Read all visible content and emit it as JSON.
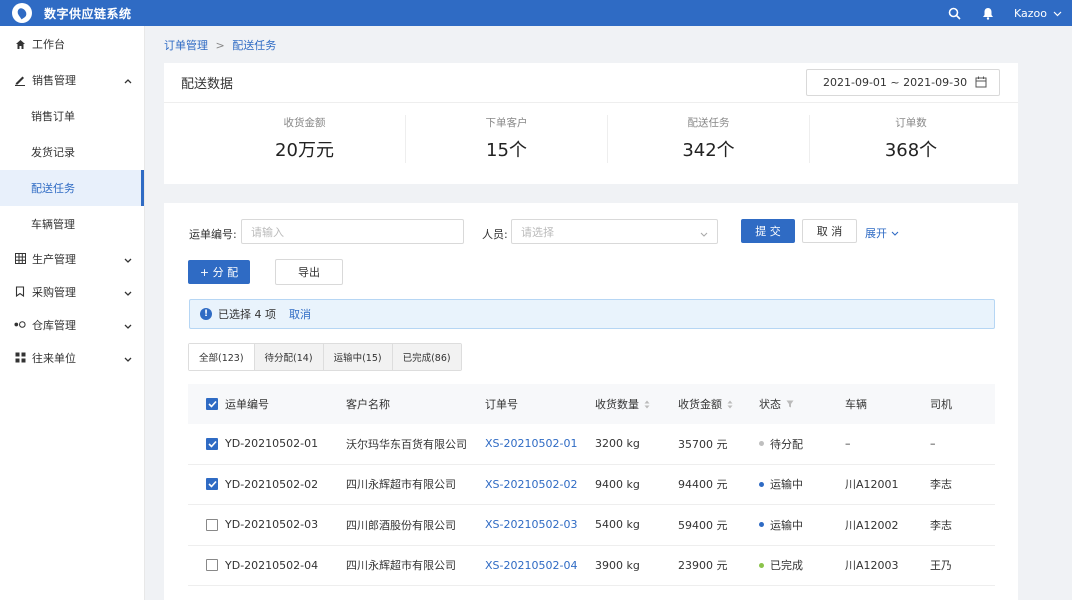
{
  "app": {
    "title": "数字供应链系统",
    "user": "Kazoo"
  },
  "sidebar": {
    "workbench": "工作台",
    "sales": {
      "label": "销售管理",
      "items": [
        "销售订单",
        "发货记录",
        "配送任务",
        "车辆管理"
      ]
    },
    "groups": [
      "生产管理",
      "采购管理",
      "仓库管理",
      "往来单位"
    ]
  },
  "breadcrumb": {
    "parent": "订单管理",
    "sep": ">",
    "current": "配送任务"
  },
  "overview": {
    "title": "配送数据",
    "date_range": "2021-09-01 ~ 2021-09-30",
    "stats": [
      {
        "label": "收货金额",
        "value": "20万元"
      },
      {
        "label": "下单客户",
        "value": "15个"
      },
      {
        "label": "配送任务",
        "value": "342个"
      },
      {
        "label": "订单数",
        "value": "368个"
      }
    ]
  },
  "filters": {
    "waybill_label": "运单编号:",
    "waybill_placeholder": "请输入",
    "person_label": "人员:",
    "person_placeholder": "请选择",
    "submit": "提 交",
    "cancel": "取 消",
    "expand": "展开"
  },
  "actions": {
    "assign": "+ 分 配",
    "export": "导出"
  },
  "alert": {
    "text": "已选择 4 项",
    "cancel": "取消"
  },
  "tabs": [
    "全部(123)",
    "待分配(14)",
    "运输中(15)",
    "已完成(86)"
  ],
  "table": {
    "headers": [
      "运单编号",
      "客户名称",
      "订单号",
      "收货数量",
      "收货金额",
      "状态",
      "车辆",
      "司机"
    ],
    "rows": [
      {
        "checked": true,
        "waybill": "YD-20210502-01",
        "customer": "沃尔玛华东百货有限公司",
        "order": "XS-20210502-01",
        "qty": "3200 kg",
        "amount": "35700 元",
        "status": "待分配",
        "status_color": "#bfbfbf",
        "vehicle": "–",
        "driver": "–"
      },
      {
        "checked": true,
        "waybill": "YD-20210502-02",
        "customer": "四川永辉超市有限公司",
        "order": "XS-20210502-02",
        "qty": "9400 kg",
        "amount": "94400 元",
        "status": "运输中",
        "status_color": "#2f6bc4",
        "vehicle": "川A12001",
        "driver": "李志"
      },
      {
        "checked": false,
        "waybill": "YD-20210502-03",
        "customer": "四川郎酒股份有限公司",
        "order": "XS-20210502-03",
        "qty": "5400 kg",
        "amount": "59400 元",
        "status": "运输中",
        "status_color": "#2f6bc4",
        "vehicle": "川A12002",
        "driver": "李志"
      },
      {
        "checked": false,
        "waybill": "YD-20210502-04",
        "customer": "四川永辉超市有限公司",
        "order": "XS-20210502-04",
        "qty": "3900 kg",
        "amount": "23900 元",
        "status": "已完成",
        "status_color": "#8bc34a",
        "vehicle": "川A12003",
        "driver": "王乃"
      }
    ]
  }
}
